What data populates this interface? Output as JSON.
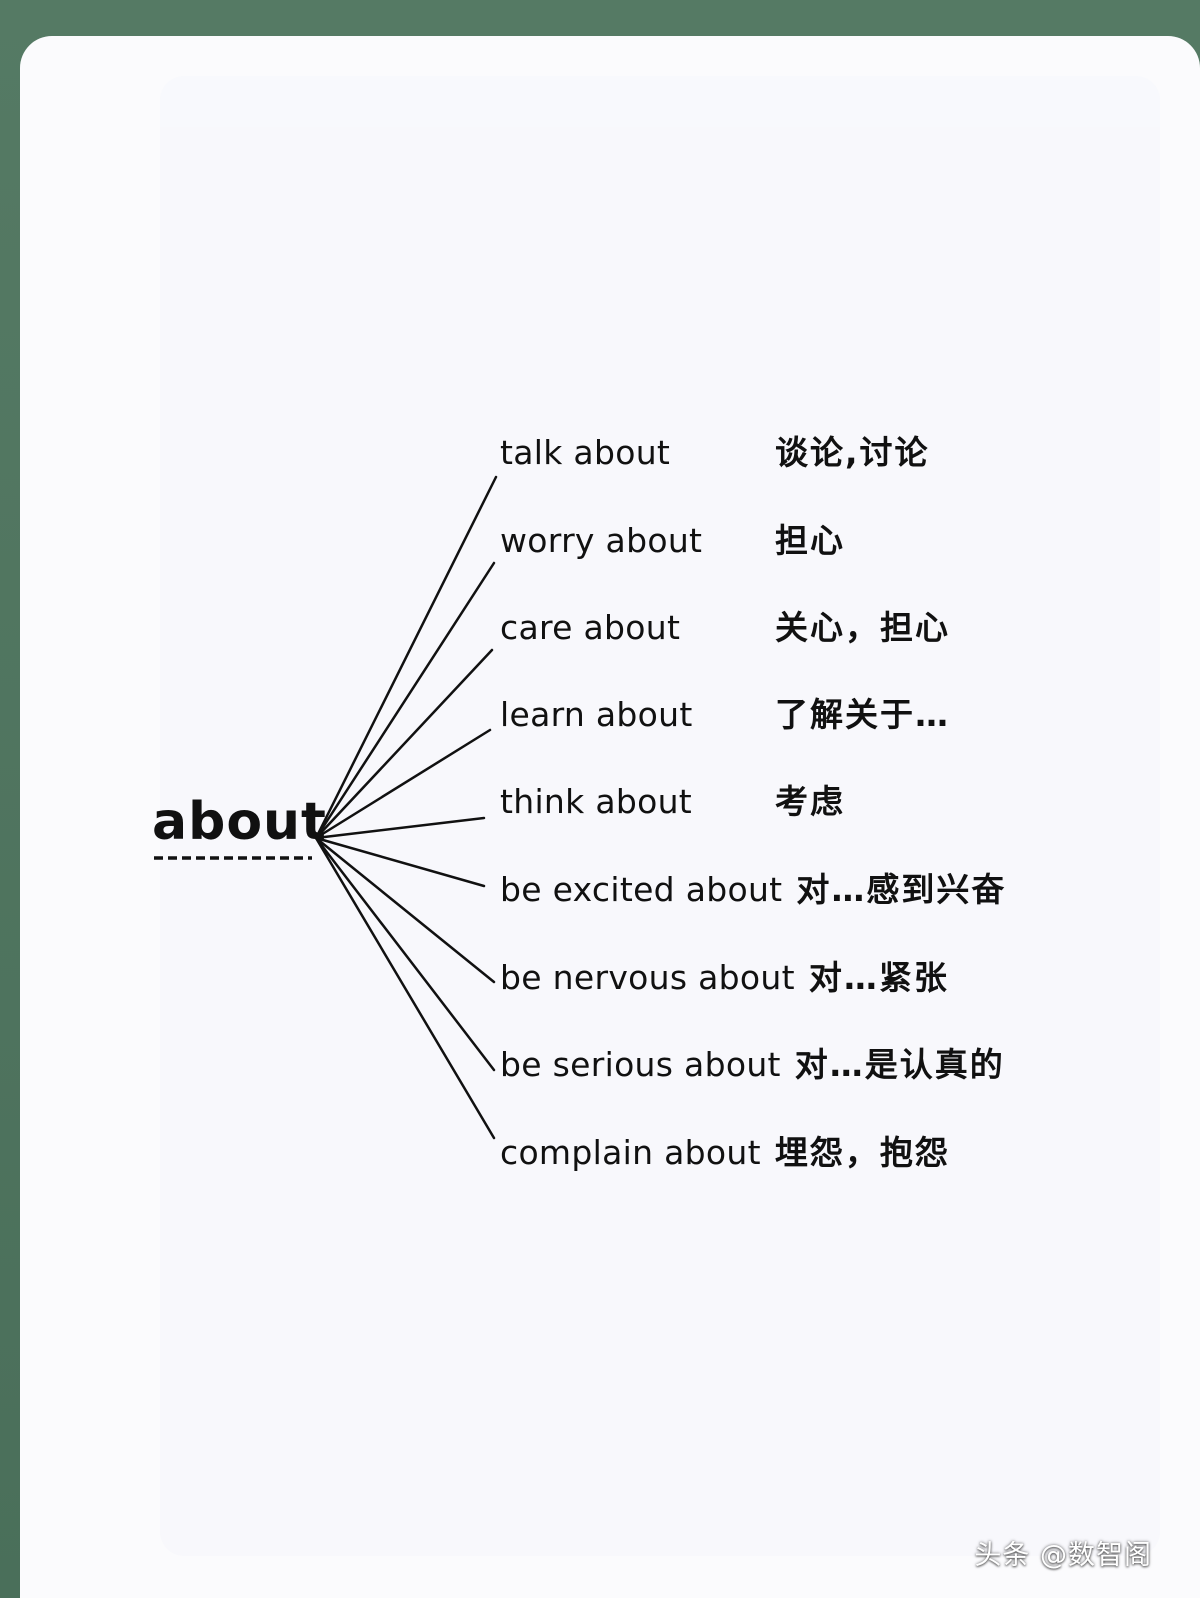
{
  "diagram": {
    "root": "about",
    "branches": [
      {
        "phrase": "talk about",
        "meaning": "谈论,讨论"
      },
      {
        "phrase": "worry about",
        "meaning": "担心"
      },
      {
        "phrase": "care about",
        "meaning": "关心，担心"
      },
      {
        "phrase": "learn about",
        "meaning": "了解关于…"
      },
      {
        "phrase": "think about",
        "meaning": "考虑"
      },
      {
        "phrase": "be excited about",
        "meaning": "对…感到兴奋"
      },
      {
        "phrase": "be nervous about",
        "meaning": "对…紧张"
      },
      {
        "phrase": "be serious about",
        "meaning": "对…是认真的"
      },
      {
        "phrase": "complain about",
        "meaning": "埋怨，抱怨"
      }
    ]
  },
  "watermark": "头条 @数智阁",
  "colors": {
    "frame": "#4f7560",
    "card": "#fbfbfd",
    "ink": "#111111"
  }
}
